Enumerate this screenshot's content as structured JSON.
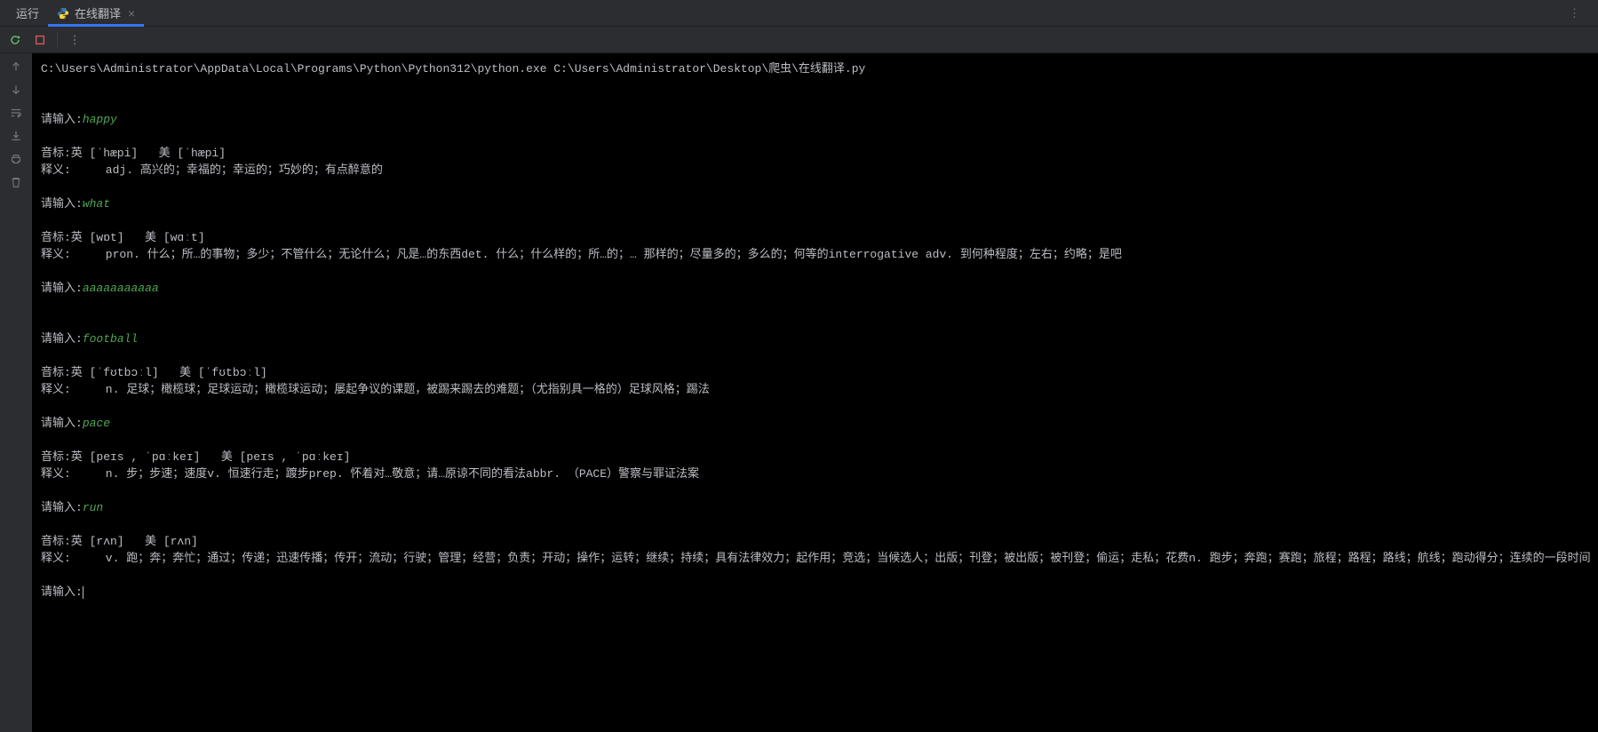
{
  "tabbar": {
    "run_label": "运行",
    "tab_name": "在线翻译",
    "close_glyph": "×",
    "more_glyph": "⋮"
  },
  "console": {
    "command": "C:\\Users\\Administrator\\AppData\\Local\\Programs\\Python\\Python312\\python.exe C:\\Users\\Administrator\\Desktop\\爬虫\\在线翻译.py",
    "prompt_label": "请输入:",
    "entries": [
      {
        "input": "happy",
        "phonetic": "音标:英 [ˈhæpi]   美 [ˈhæpi]",
        "definition": "释义:     adj. 高兴的；幸福的；幸运的；巧妙的；有点醉意的"
      },
      {
        "input": "what",
        "phonetic": "音标:英 [wɒt]   美 [wɑːt]",
        "definition": "释义:     pron. 什么；所…的事物；多少；不管什么；无论什么；凡是…的东西det. 什么；什么样的；所…的；… 那样的；尽量多的；多么的；何等的interrogative adv. 到何种程度；左右；约略；是吧"
      },
      {
        "input": "aaaaaaaaaaa",
        "phonetic": "",
        "definition": ""
      },
      {
        "input": "football",
        "phonetic": "音标:英 [ˈfʊtbɔːl]   美 [ˈfʊtbɔːl]",
        "definition": "释义:     n. 足球；橄榄球；足球运动；橄榄球运动；屡起争议的课题，被踢来踢去的难题；（尤指别具一格的）足球风格；踢法"
      },
      {
        "input": "pace",
        "phonetic": "音标:英 [peɪs , ˈpɑːkeɪ]   美 [peɪs , ˈpɑːkeɪ]",
        "definition": "释义:     n. 步；步速；速度v. 恒速行走；踱步prep. 怀着对…敬意；请…原谅不同的看法abbr. （PACE）警察与罪证法案"
      },
      {
        "input": "run",
        "phonetic": "音标:英 [rʌn]   美 [rʌn]",
        "definition": "释义:     v. 跑；奔；奔忙；通过；传递；迅速传播；传开；流动；行驶；管理；经营；负责；开动；操作；运转；继续；持续；具有法律效力；起作用；竞选；当候选人；出版；刊登；被出版；被刊登；偷运；走私；花费n. 跑步；奔跑；赛跑；旅程；路程；路线；航线；跑动得分；连续的一段时间"
      }
    ],
    "final_prompt": "请输入:"
  }
}
